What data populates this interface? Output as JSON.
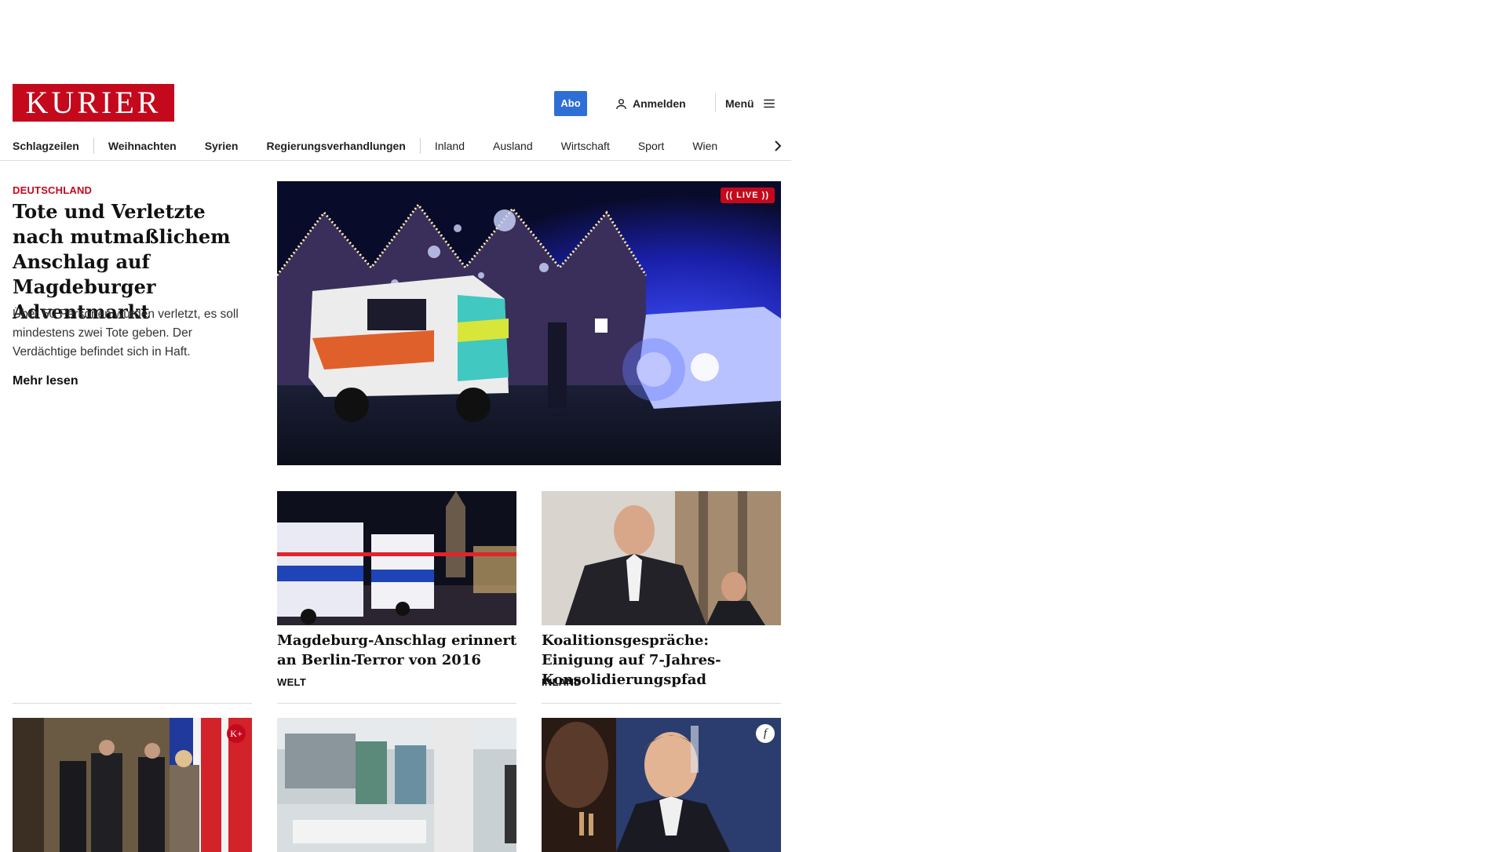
{
  "header": {
    "logo_text": "KURIER",
    "abo_label": "Abo",
    "login_label": "Anmelden",
    "menu_label": "Menü"
  },
  "nav": {
    "items": [
      "Schlagzeilen",
      "Weihnachten",
      "Syrien",
      "Regierungsverhandlungen",
      "Inland",
      "Ausland",
      "Wirtschaft",
      "Sport",
      "Wien"
    ]
  },
  "lead": {
    "kicker": "DEUTSCHLAND",
    "title": "Tote und Verletzte nach mutmaßlichem Anschlag auf Magdeburger Adventmarkt",
    "teaser": "Über 50 Personen wurden verletzt, es soll mindestens zwei Tote geben. Der Verdächtige befindet sich in Haft.",
    "more": "Mehr lesen",
    "live_label": "LIVE"
  },
  "cards": [
    {
      "title": "Magdeburg-Anschlag erinnert an Berlin-Terror von 2016",
      "category": "WELT"
    },
    {
      "title": "Koalitionsgespräche: Einigung auf 7-Jahres-Konsolidierungspfad",
      "category": "INLAND"
    }
  ],
  "bottom_badges": {
    "kplus": "K+",
    "f": "f"
  },
  "colors": {
    "brand": "#c4091c",
    "abo": "#2d6fd4"
  }
}
